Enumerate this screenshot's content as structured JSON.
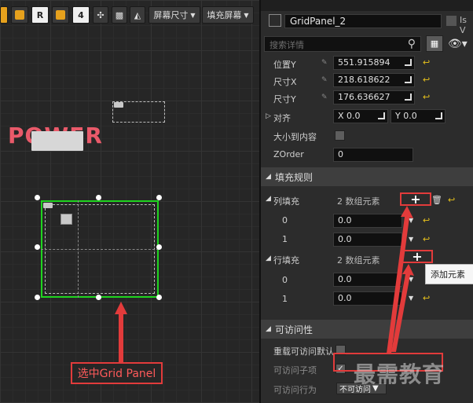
{
  "toolbar": {
    "r_label": "R",
    "four_label": "4",
    "screen_size_label": "屏幕尺寸",
    "fill_screen_label": "填充屏幕"
  },
  "canvas": {
    "power_text": "POWER",
    "annotation_text": "选中Grid Panel"
  },
  "details": {
    "widget_name": "GridPanel_2",
    "is_variable_label": "Is V",
    "search_placeholder": "搜索详情",
    "props": {
      "pos_y_label": "位置Y",
      "pos_y_value": "551.915894",
      "size_x_label": "尺寸X",
      "size_x_value": "218.618622",
      "size_y_label": "尺寸Y",
      "size_y_value": "176.636627",
      "align_label": "对齐",
      "align_x": "X  0.0",
      "align_y": "Y  0.0",
      "size_to_content_label": "大小到内容",
      "zorder_label": "ZOrder",
      "zorder_value": "0"
    },
    "fill_rules": {
      "category_label": "填充规则",
      "column_fill_label": "列填充",
      "column_count": "2 数组元素",
      "column_items": [
        {
          "index": "0",
          "value": "0.0"
        },
        {
          "index": "1",
          "value": "0.0"
        }
      ],
      "row_fill_label": "行填充",
      "row_count": "2 数组元素",
      "row_items": [
        {
          "index": "0",
          "value": "0.0"
        },
        {
          "index": "1",
          "value": "0.0"
        }
      ],
      "add_tooltip": "添加元素"
    },
    "accessibility": {
      "category_label": "可访问性",
      "override_label": "重载可访问默认",
      "child_label": "可访问子项",
      "behavior_label": "可访问行为",
      "behavior_value": "不可访问"
    }
  },
  "watermark": "最需教育",
  "colors": {
    "selection_green": "#1fd41f",
    "annotation_red": "#e23b3b",
    "power_pink": "#e95a6a",
    "reset_yellow": "#e6c01c",
    "toolbar_orange": "#e6a11d"
  },
  "icons": [
    "grid-toggle-icon",
    "image-icon",
    "layout-icon",
    "search-icon",
    "eye-icon",
    "trash-icon",
    "plus-icon",
    "reset-arrow-icon",
    "resize-icon"
  ]
}
